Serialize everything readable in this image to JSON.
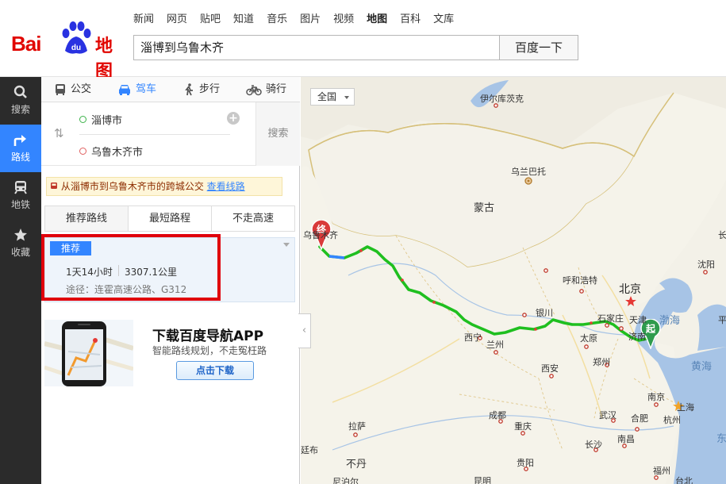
{
  "header": {
    "nav": [
      "新闻",
      "网页",
      "贴吧",
      "知道",
      "音乐",
      "图片",
      "视频",
      "地图",
      "百科",
      "文库"
    ],
    "nav_active": "地图",
    "search_value": "淄博到乌鲁木齐",
    "search_button": "百度一下",
    "logo_text": "Bai du 地图"
  },
  "rail": [
    {
      "label": "搜索",
      "icon": "search-icon"
    },
    {
      "label": "路线",
      "icon": "route-icon",
      "active": true
    },
    {
      "label": "地铁",
      "icon": "subway-icon"
    },
    {
      "label": "收藏",
      "icon": "star-icon"
    }
  ],
  "modes": [
    {
      "label": "公交",
      "icon": "bus-icon"
    },
    {
      "label": "驾车",
      "icon": "car-icon",
      "active": true
    },
    {
      "label": "步行",
      "icon": "walk-icon"
    },
    {
      "label": "骑行",
      "icon": "bike-icon"
    }
  ],
  "route": {
    "start": "淄博市",
    "end": "乌鲁木齐市",
    "search_button": "搜索"
  },
  "notice": {
    "text": "从淄博市到乌鲁木齐市的跨城公交",
    "link": "查看线路"
  },
  "sort_tabs": [
    "推荐路线",
    "最短路程",
    "不走高速"
  ],
  "result": {
    "tag": "推荐",
    "duration": "1天14小时",
    "distance": "3307.1公里",
    "via": "途径：连霍高速公路、G312"
  },
  "ad": {
    "title": "下载百度导航APP",
    "subtitle": "智能路线规划，不走冤枉路",
    "button": "点击下载"
  },
  "map": {
    "country_button": "全国",
    "start_marker": "起",
    "end_marker": "终",
    "labels": {
      "irkutsk": "伊尔库茨克",
      "ulaanbaatar": "乌兰巴托",
      "mongolia": "蒙古",
      "urumqi": "乌鲁木齐",
      "hohhot": "呼和浩特",
      "beijing": "北京",
      "shenyang": "沈阳",
      "changchun": "长",
      "tianjin": "天津",
      "bohai": "渤海",
      "shijiazhuang": "石家庄",
      "yinchuan": "银川",
      "xining": "西宁",
      "lanzhou": "兰州",
      "taiyuan": "太原",
      "jinan": "济南",
      "xian": "西安",
      "zhengzhou": "郑州",
      "yellow_sea": "黄海",
      "nanjing": "南京",
      "shanghai": "上海",
      "hefei": "合肥",
      "hangzhou": "杭州",
      "wuhan": "武汉",
      "chengdu": "成都",
      "chongqing": "重庆",
      "lasa": "拉萨",
      "changsha": "长沙",
      "nanchang": "南昌",
      "guiyang": "贵阳",
      "fuzhou": "福州",
      "bhutan": "不丹",
      "kunming": "昆明",
      "taibei": "台北",
      "east_sea": "东",
      "pyongyang": "平",
      "thimphu": "廷布",
      "nepal": "尼泊尔"
    }
  },
  "colors": {
    "brand_red": "#e10601",
    "brand_blue": "#3385ff",
    "route_green": "#1fbf1f",
    "highlight_red": "#e0000b"
  }
}
